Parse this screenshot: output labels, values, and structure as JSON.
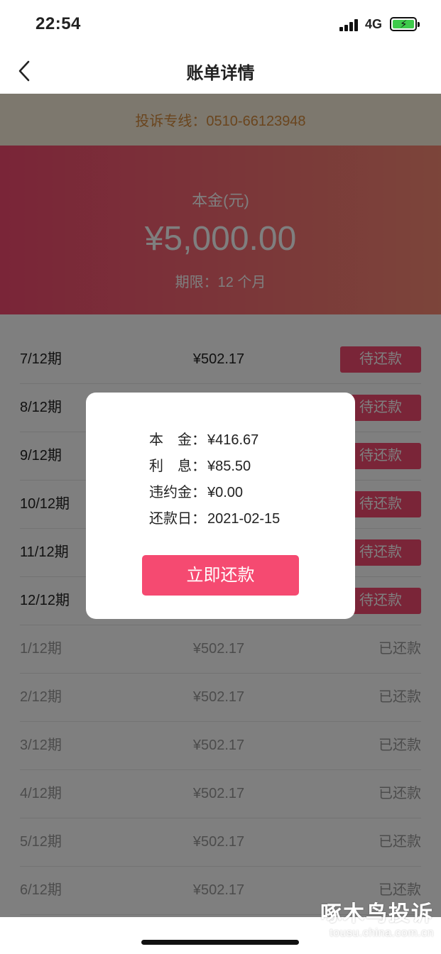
{
  "status_bar": {
    "time": "22:54",
    "network": "4G",
    "battery_icon": "battery-charging-icon"
  },
  "nav": {
    "title": "账单详情",
    "back_icon": "chevron-left-icon"
  },
  "hotline": {
    "text": "投诉专线：0510-66123948"
  },
  "summary": {
    "label": "本金(元)",
    "amount": "¥5,000.00",
    "term": "期限：12 个月"
  },
  "bills": [
    {
      "period": "7/12期",
      "amount": "¥502.17",
      "status": "待还款"
    },
    {
      "period": "8/12期",
      "amount": "",
      "status": "待还款"
    },
    {
      "period": "9/12期",
      "amount": "",
      "status": "待还款"
    },
    {
      "period": "10/12期",
      "amount": "",
      "status": "待还款"
    },
    {
      "period": "11/12期",
      "amount": "",
      "status": "待还款"
    },
    {
      "period": "12/12期",
      "amount": "",
      "status": "待还款"
    },
    {
      "period": "1/12期",
      "amount": "¥502.17",
      "status": "已还款"
    },
    {
      "period": "2/12期",
      "amount": "¥502.17",
      "status": "已还款"
    },
    {
      "period": "3/12期",
      "amount": "¥502.17",
      "status": "已还款"
    },
    {
      "period": "4/12期",
      "amount": "¥502.17",
      "status": "已还款"
    },
    {
      "period": "5/12期",
      "amount": "¥502.17",
      "status": "已还款"
    },
    {
      "period": "6/12期",
      "amount": "¥502.17",
      "status": "已还款"
    }
  ],
  "modal": {
    "principal_key": "本　金：",
    "principal": "¥416.67",
    "interest_key": "利　息：",
    "interest": "¥85.50",
    "penalty_key": "违约金：",
    "penalty": "¥0.00",
    "due_key": "还款日：",
    "due_date": "2021-02-15",
    "pay_button": "立即还款"
  },
  "watermark": {
    "main": "啄木鸟投诉",
    "sub": "tousu.china.com.cn"
  },
  "colors": {
    "accent": "#f54a71",
    "hotline_bg": "#fbf1dc",
    "hotline_text": "#d48a3c"
  }
}
